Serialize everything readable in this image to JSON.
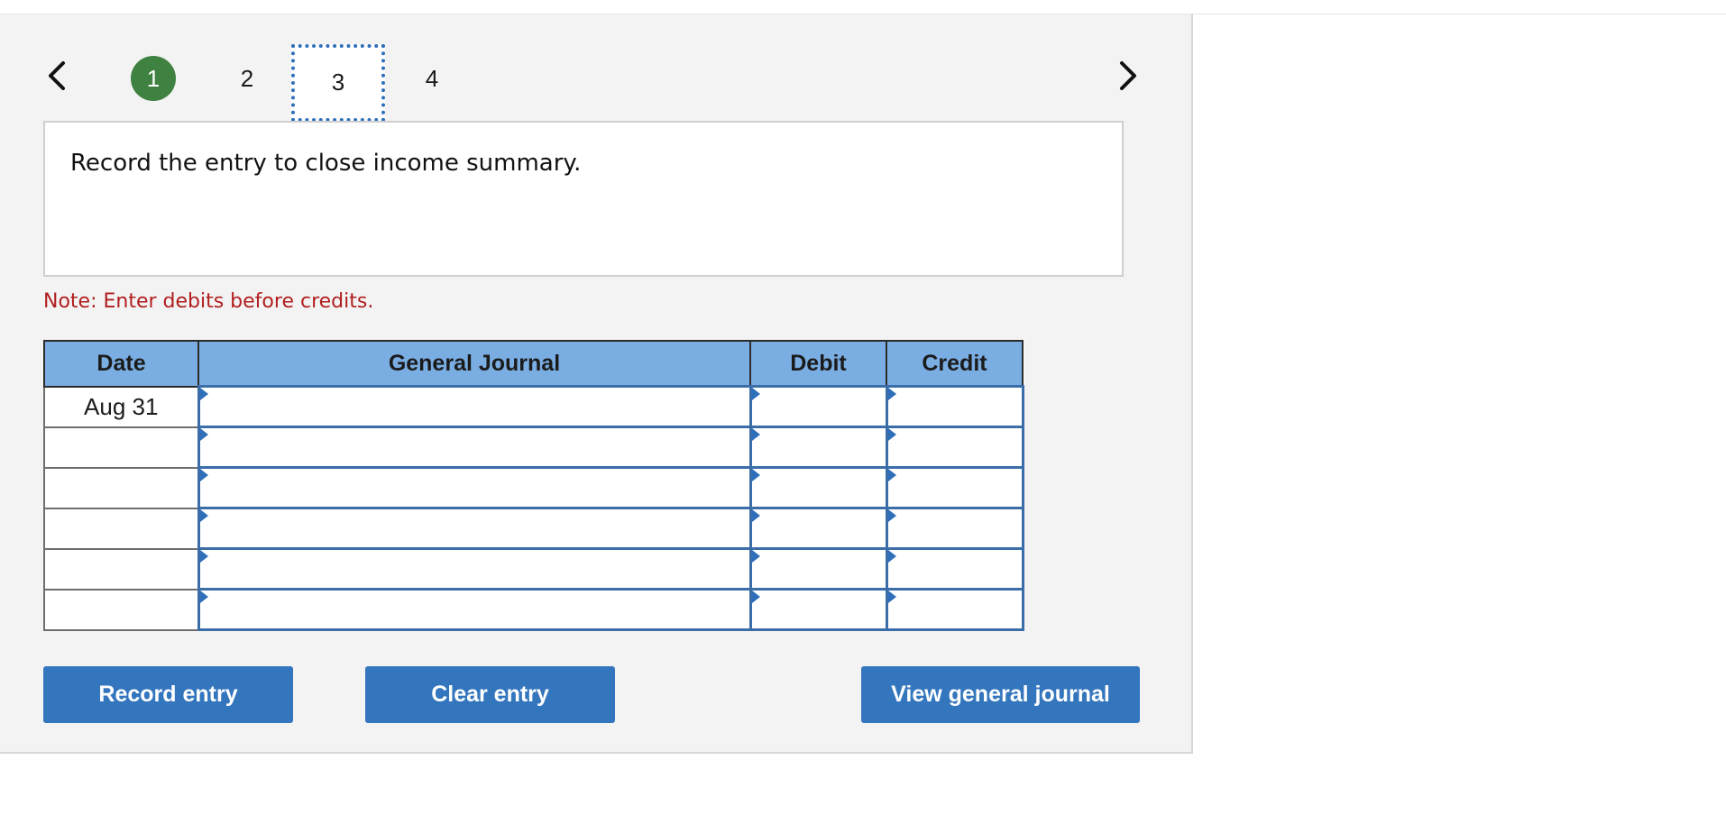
{
  "stepper": {
    "steps": [
      "1",
      "2",
      "3",
      "4"
    ],
    "active_step": "1",
    "focused_step": "3"
  },
  "icons": {
    "prev": "chevron-left-icon",
    "next": "chevron-right-icon"
  },
  "prompt": {
    "text": "Record the entry to close income summary."
  },
  "note": "Note: Enter debits before credits.",
  "journal": {
    "headers": {
      "date": "Date",
      "general_journal": "General Journal",
      "debit": "Debit",
      "credit": "Credit"
    },
    "rows": [
      {
        "date": "Aug 31",
        "account": "",
        "debit": "",
        "credit": ""
      },
      {
        "date": "",
        "account": "",
        "debit": "",
        "credit": ""
      },
      {
        "date": "",
        "account": "",
        "debit": "",
        "credit": ""
      },
      {
        "date": "",
        "account": "",
        "debit": "",
        "credit": ""
      },
      {
        "date": "",
        "account": "",
        "debit": "",
        "credit": ""
      },
      {
        "date": "",
        "account": "",
        "debit": "",
        "credit": ""
      }
    ]
  },
  "buttons": {
    "record": "Record entry",
    "clear": "Clear entry",
    "view": "View general journal"
  },
  "colors": {
    "active_step": "#3e8141",
    "header_bg": "#7aaee3",
    "button_bg": "#3476bd",
    "note_text": "#b11e1e",
    "focus_outline": "#2f6fba"
  }
}
